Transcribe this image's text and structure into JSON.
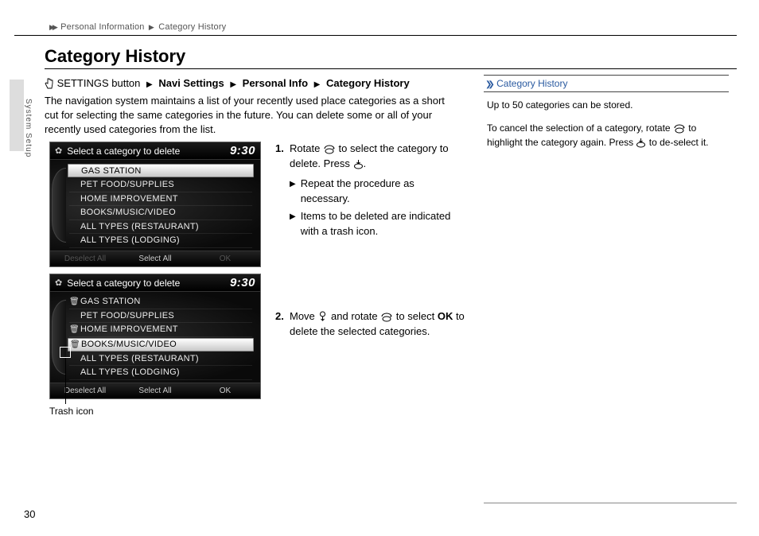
{
  "breadcrumb": {
    "a": "Personal Information",
    "b": "Category History"
  },
  "title": "Category History",
  "side_tab": "System Setup",
  "navpath": {
    "pre": "SETTINGS button",
    "p1": "Navi Settings",
    "p2": "Personal Info",
    "p3": "Category History"
  },
  "intro": "The navigation system maintains a list of your recently used place categories as a short cut for selecting the same categories in the future. You can delete some or all of your recently used categories from the list.",
  "shot": {
    "head": "Select a category to delete",
    "clock": "9:30",
    "rows": [
      "GAS STATION",
      "PET FOOD/SUPPLIES",
      "HOME IMPROVEMENT",
      "BOOKS/MUSIC/VIDEO",
      "ALL TYPES (RESTAURANT)",
      "ALL TYPES (LODGING)"
    ],
    "foot_deselect": "Deselect All",
    "foot_select": "Select All",
    "foot_ok": "OK"
  },
  "trash_label": "Trash icon",
  "steps": {
    "s1a": "Rotate ",
    "s1b": " to select the category to delete. Press ",
    "s1c": ".",
    "sub1": "Repeat the procedure as necessary.",
    "sub2": "Items to be deleted are indicated with a trash icon.",
    "s2a": "Move ",
    "s2b": " and rotate ",
    "s2c": " to select ",
    "s2ok": "OK",
    "s2d": " to delete the selected categories."
  },
  "side": {
    "head": "Category History",
    "p1": "Up to 50 categories can be stored.",
    "p2a": "To cancel the selection of a category, rotate ",
    "p2b": " to highlight the category again. Press ",
    "p2c": " to de-select it."
  },
  "page": "30"
}
